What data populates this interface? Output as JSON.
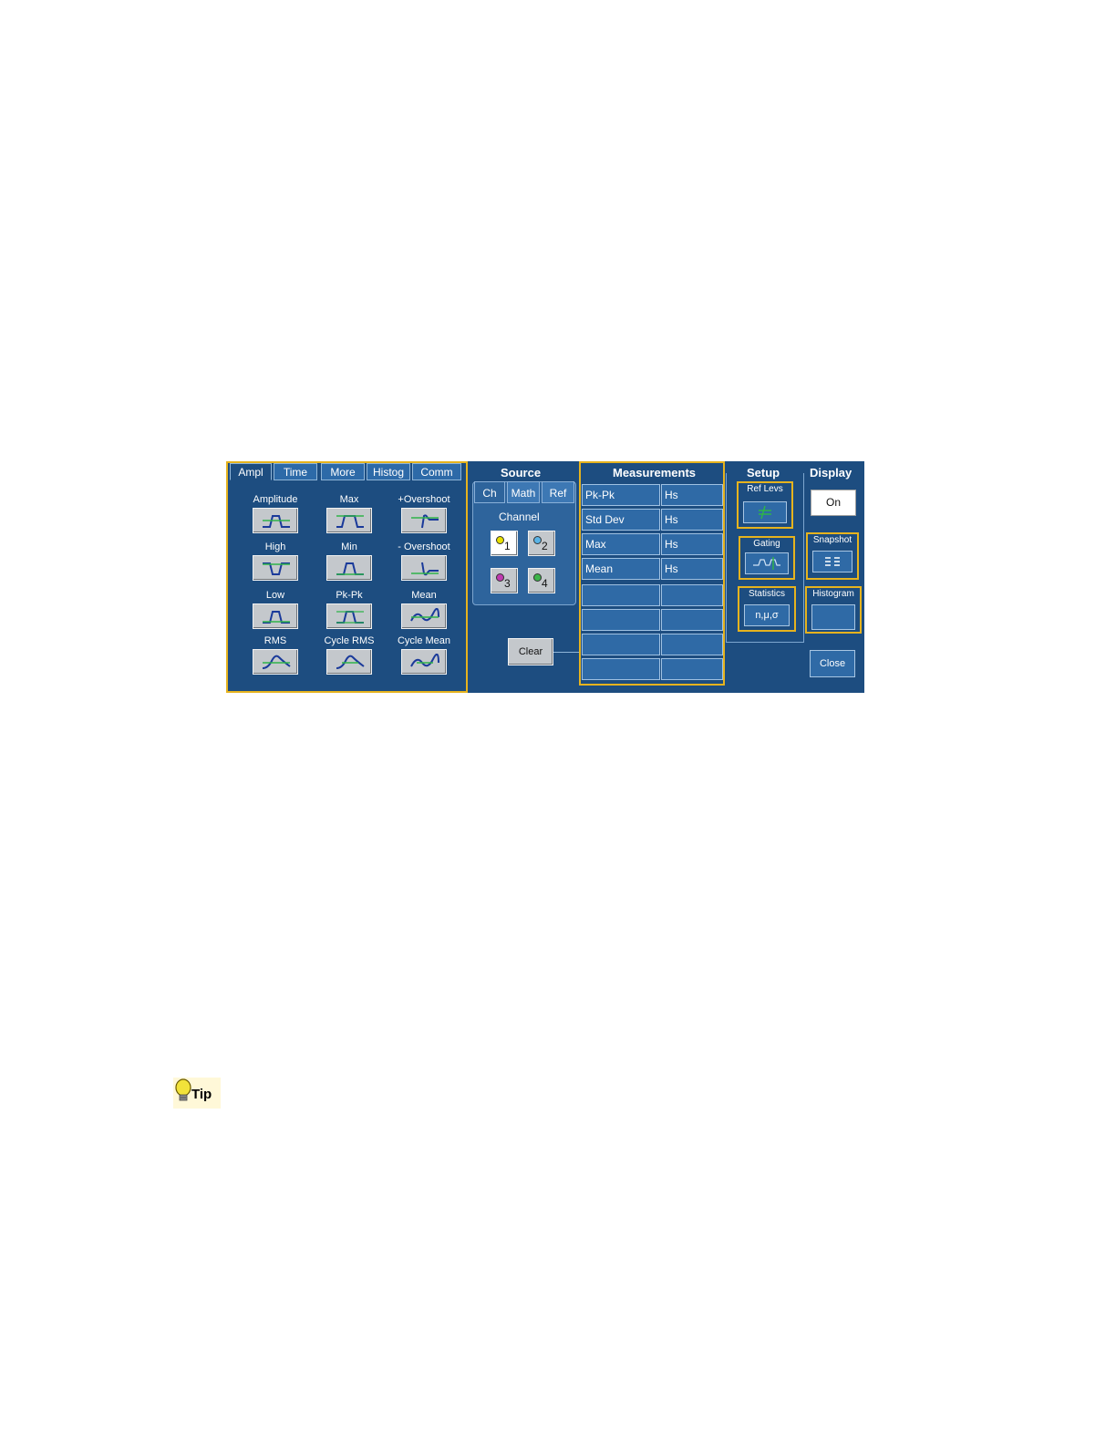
{
  "tabs": [
    "Ampl",
    "Time",
    "More",
    "Histog",
    "Comm"
  ],
  "measure_buttons": [
    {
      "label": "Amplitude"
    },
    {
      "label": "Max"
    },
    {
      "label": "+Overshoot"
    },
    {
      "label": "High"
    },
    {
      "label": "Min"
    },
    {
      "label": "- Overshoot"
    },
    {
      "label": "Low"
    },
    {
      "label": "Pk-Pk"
    },
    {
      "label": "Mean"
    },
    {
      "label": "RMS"
    },
    {
      "label": "Cycle RMS"
    },
    {
      "label": "Cycle Mean"
    }
  ],
  "source": {
    "title": "Source",
    "tabs": [
      "Ch",
      "Math",
      "Ref"
    ],
    "channel_label": "Channel",
    "channels": [
      {
        "num": "1",
        "color": "#e8e000"
      },
      {
        "num": "2",
        "color": "#5ab4e6"
      },
      {
        "num": "3",
        "color": "#c03ab0"
      },
      {
        "num": "4",
        "color": "#3cb44a"
      }
    ],
    "clear_label": "Clear"
  },
  "measurements": {
    "title": "Measurements",
    "rows": [
      [
        "Pk-Pk",
        "Hs"
      ],
      [
        "Std Dev",
        "Hs"
      ],
      [
        "Max",
        "Hs"
      ],
      [
        "Mean",
        "Hs"
      ],
      [
        "",
        ""
      ],
      [
        "",
        ""
      ],
      [
        "",
        ""
      ],
      [
        "",
        ""
      ]
    ]
  },
  "setup": {
    "title": "Setup",
    "ref_levs": "Ref Levs",
    "gating": "Gating",
    "statistics": "Statistics",
    "statistics_value": "n,μ,σ"
  },
  "display": {
    "title": "Display",
    "state": "On",
    "snapshot": "Snapshot",
    "histogram": "Histogram",
    "close": "Close"
  },
  "tip": {
    "label": "Tip"
  },
  "colors": {
    "panel": "#1d4d80",
    "highlight": "#e6b31e",
    "waveform_green": "#2fb34a",
    "waveform_blue": "#1a3a9a"
  }
}
